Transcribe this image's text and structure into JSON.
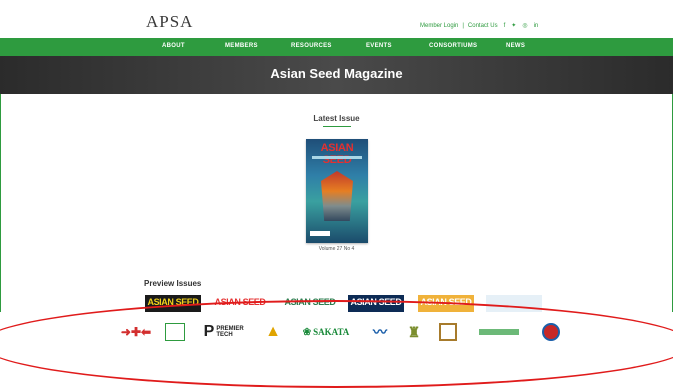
{
  "header": {
    "logo": "APSA",
    "links": [
      "Member Login",
      "Contact Us"
    ],
    "social_icons": [
      "facebook-icon",
      "twitter-icon",
      "instagram-icon",
      "linkedin-icon"
    ]
  },
  "nav": {
    "items": [
      "ABOUT",
      "MEMBERS",
      "RESOURCES",
      "EVENTS",
      "CONSORTIUMS",
      "NEWS"
    ]
  },
  "banner": {
    "title": "Asian Seed Magazine"
  },
  "latest": {
    "heading": "Latest Issue",
    "cover_title": "ASIAN SEED",
    "caption": "Volume 27 No 4"
  },
  "preview": {
    "heading": "Preview Issues",
    "issues": [
      {
        "label": "ASIAN SEED",
        "bg": "#1a1a1a",
        "fg": "#f2d21b"
      },
      {
        "label": "ASIAN SEED",
        "bg": "#ffffff",
        "fg": "#e53030"
      },
      {
        "label": "ASIAN SEED",
        "bg": "#ffffff",
        "fg": "#2e7d4f"
      },
      {
        "label": "ASIAN SEED",
        "bg": "#0d2b55",
        "fg": "#ffffff"
      },
      {
        "label": "ASIAN SEED",
        "bg": "#f0b23a",
        "fg": "#ffffff"
      },
      {
        "label": "",
        "bg": "#e6f0f7",
        "fg": "#999999"
      }
    ]
  },
  "sponsors": [
    {
      "name": "",
      "color": "#d32f2f",
      "icon": "arrows-logo-icon"
    },
    {
      "name": "",
      "color": "#2e9b3f",
      "icon": "box-logo-icon"
    },
    {
      "name": "PREMIER TECH",
      "color": "#222222",
      "icon": "premier-tech-logo-icon"
    },
    {
      "name": "",
      "color": "#e0a400",
      "icon": "triangle-logo-icon"
    },
    {
      "name": "SAKATA",
      "color": "#1a8a3a",
      "icon": "sakata-logo-icon"
    },
    {
      "name": "",
      "color": "#1b5faa",
      "icon": "wave-logo-icon"
    },
    {
      "name": "",
      "color": "#7b8e2e",
      "icon": "tower-logo-icon"
    },
    {
      "name": "",
      "color": "#a77b2c",
      "icon": "square-logo-icon"
    },
    {
      "name": "",
      "color": "#2e9b3f",
      "icon": "korean-logo-icon"
    },
    {
      "name": "",
      "color": "#c62828",
      "icon": "round-logo-icon"
    }
  ],
  "colors": {
    "brand_green": "#2e9b3f",
    "annotation_red": "#e01b1b"
  }
}
